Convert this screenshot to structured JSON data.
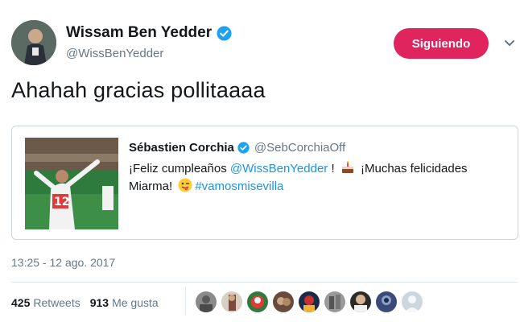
{
  "tweet": {
    "author_name": "Wissam Ben Yedder",
    "handle": "@WissBenYedder",
    "follow_label": "Siguiendo",
    "text": "Ahahah gracias pollitaaaa",
    "timestamp": "13:25 - 12 ago. 2017"
  },
  "quoted": {
    "author_name": "Sébastien Corchia",
    "handle": "@SebCorchiaOff",
    "text_part1": "¡Feliz cumpleaños ",
    "mention": "@WissBenYedder",
    "text_part2": " ! ",
    "text_part3": " ¡Muchas felicidades Miarma! ",
    "hashtag": "#vamosmisevilla"
  },
  "stats": {
    "retweets_count": "425",
    "retweets_label": "Retweets",
    "likes_count": "913",
    "likes_label": "Me gusta"
  },
  "icons": {
    "verified": "verified-badge-icon",
    "caret": "chevron-down-icon",
    "cake": "cake-emoji",
    "wink": "winking-tongue-emoji"
  },
  "colors": {
    "follow_button": "#e0245e",
    "link": "#1b95e0",
    "verified": "#1da1f2",
    "muted": "#657786"
  }
}
